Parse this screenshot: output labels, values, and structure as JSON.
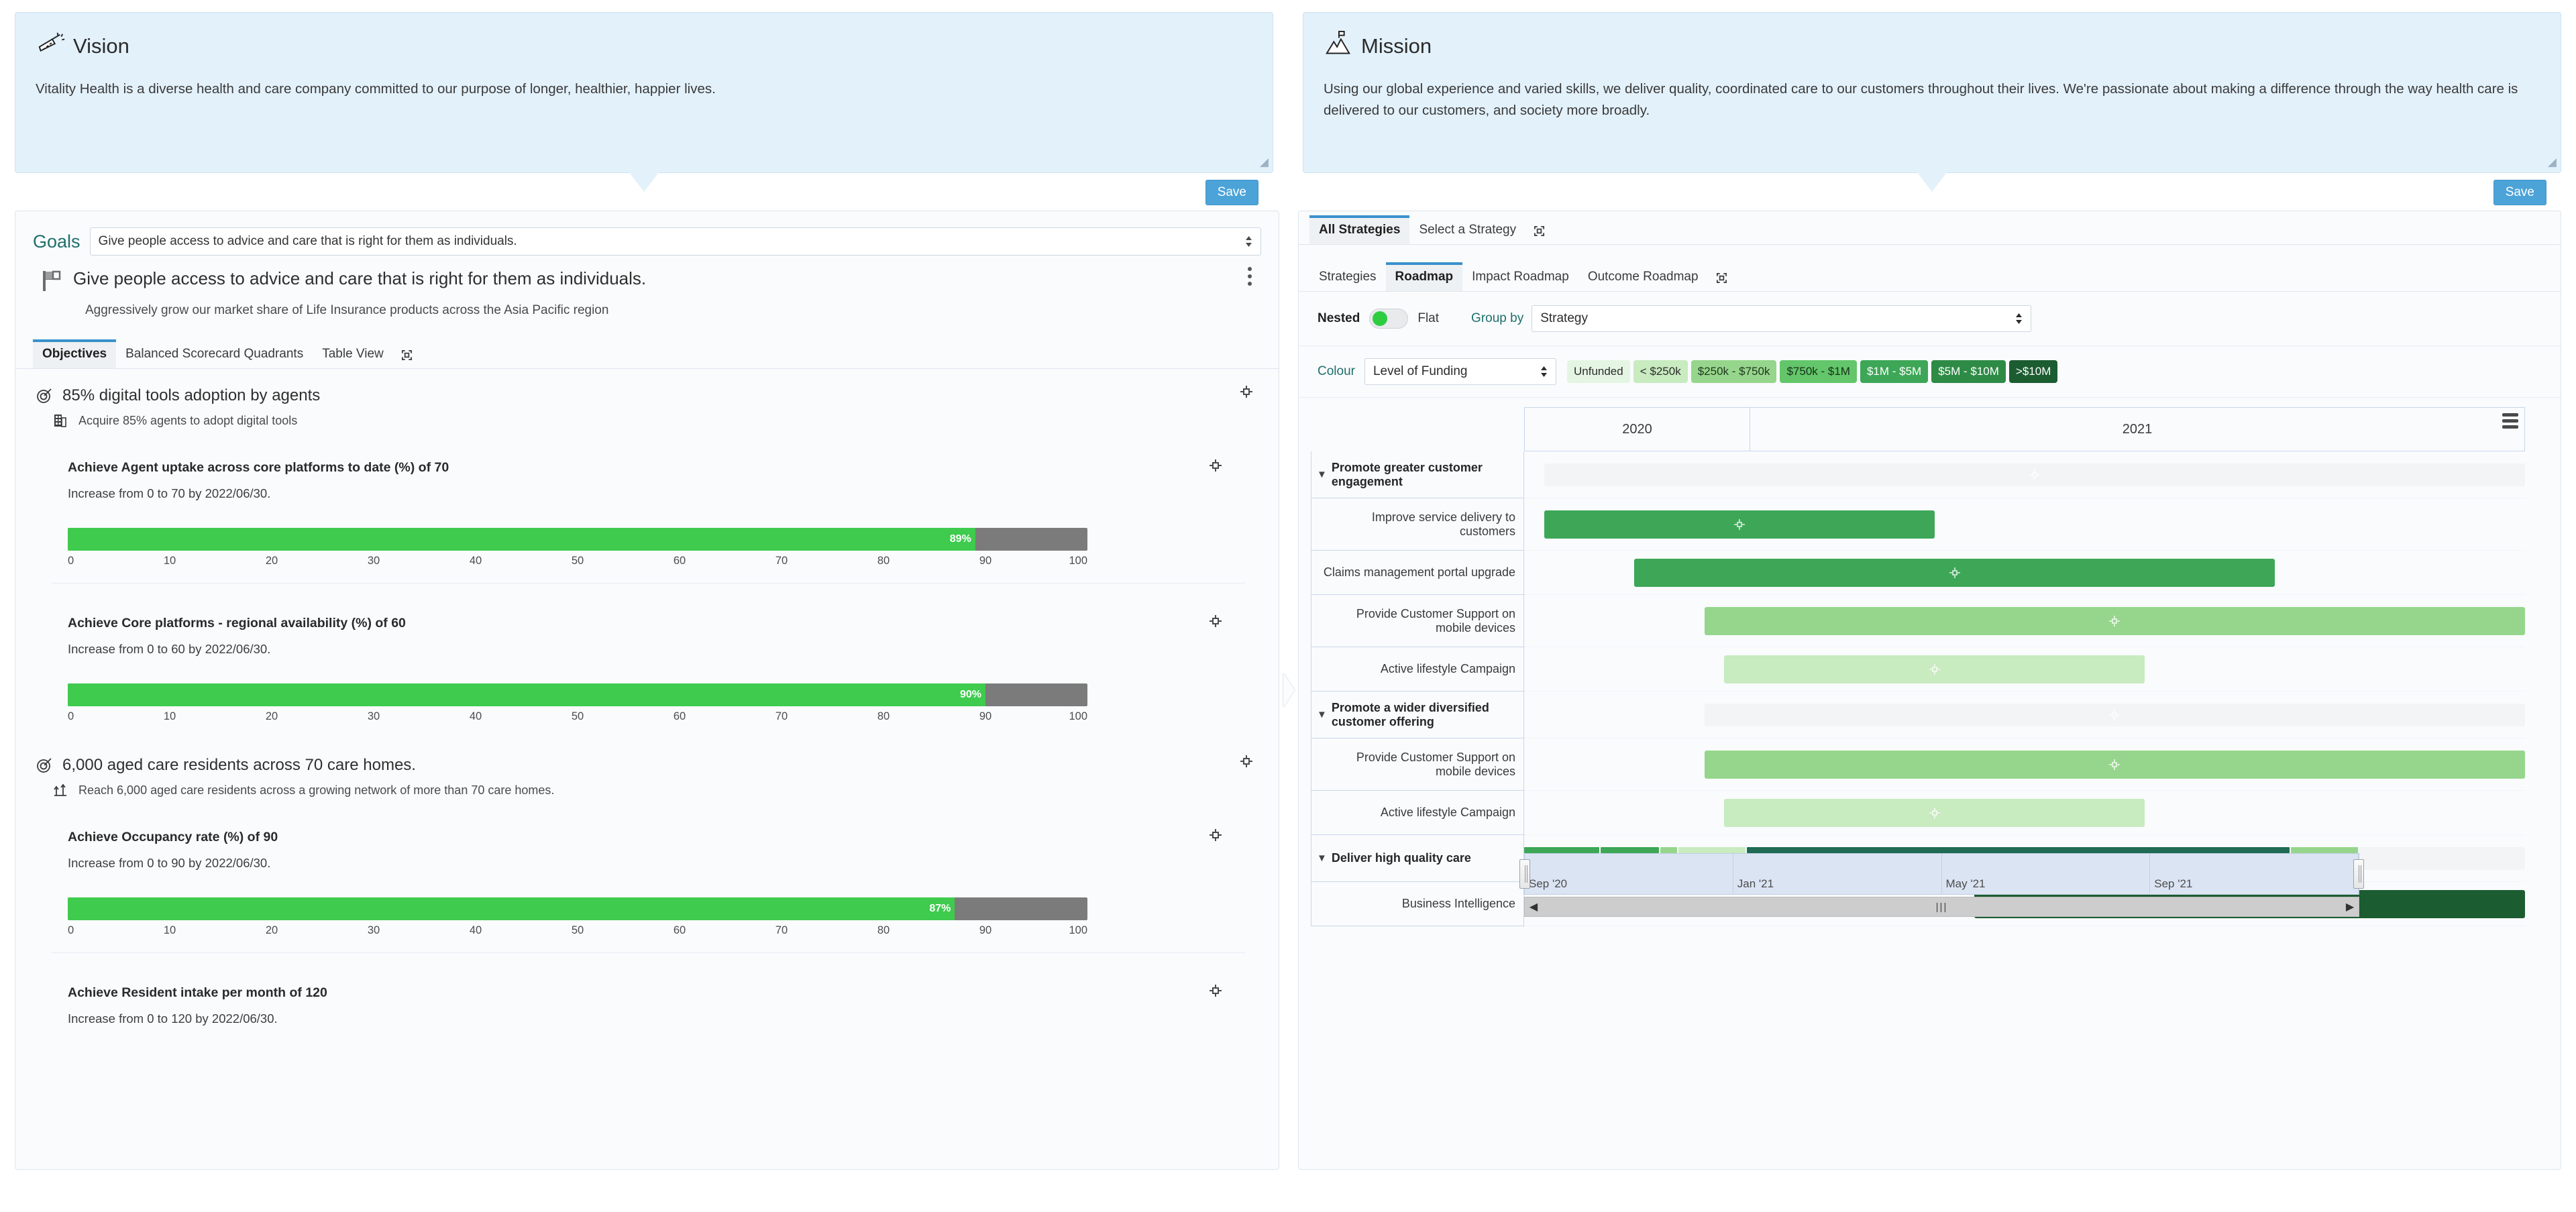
{
  "vision": {
    "title": "Vision",
    "icon": "telescope-icon",
    "text": "Vitality Health is a diverse health and care company committed to our purpose of longer, healthier, happier lives.",
    "save_label": "Save"
  },
  "mission": {
    "title": "Mission",
    "icon": "summit-flag-icon",
    "text": "Using our global experience and varied skills, we deliver quality, coordinated care to our customers throughout their lives. We're passionate about making a difference through the way health care is delivered to our customers, and society more broadly.",
    "save_label": "Save"
  },
  "goals": {
    "label": "Goals",
    "selected": "Give people access to advice and care that is right for them as individuals.",
    "goal_title": "Give people access to advice and care that is right for them as individuals.",
    "goal_subtitle": "Aggressively grow our market share of Life Insurance products across the Asia Pacific region",
    "tabs": [
      {
        "label": "Objectives",
        "active": true
      },
      {
        "label": "Balanced Scorecard Quadrants",
        "active": false
      },
      {
        "label": "Table View",
        "active": false
      }
    ],
    "objectives": [
      {
        "title": "85% digital tools adoption by agents",
        "subtitle": "Acquire 85% agents to adopt digital tools",
        "key_results": [
          {
            "title": "Achieve Agent uptake across core platforms to date (%) of 70",
            "desc": "Increase from 0 to 70 by 2022/06/30.",
            "percent": 89,
            "percent_label": "89%"
          },
          {
            "title": "Achieve Core platforms - regional availability (%) of 60",
            "desc": "Increase from 0 to 60 by 2022/06/30.",
            "percent": 90,
            "percent_label": "90%"
          }
        ]
      },
      {
        "title": "6,000 aged care residents across 70 care homes.",
        "subtitle": "Reach 6,000 aged care residents across a growing network of more than 70 care homes.",
        "key_results": [
          {
            "title": "Achieve Occupancy rate (%) of 90",
            "desc": "Increase from 0 to 90 by 2022/06/30.",
            "percent": 87,
            "percent_label": "87%"
          },
          {
            "title": "Achieve Resident intake per month of 120",
            "desc": "Increase from 0 to 120 by 2022/06/30.",
            "percent": 0,
            "percent_label": ""
          }
        ]
      }
    ],
    "axis_ticks": [
      "0",
      "10",
      "20",
      "30",
      "40",
      "50",
      "60",
      "70",
      "80",
      "90",
      "100"
    ]
  },
  "strategy": {
    "outer_tabs": [
      {
        "label": "All Strategies",
        "active": true
      },
      {
        "label": "Select a Strategy",
        "active": false
      }
    ],
    "inner_tabs": [
      {
        "label": "Strategies",
        "active": false
      },
      {
        "label": "Roadmap",
        "active": true
      },
      {
        "label": "Impact Roadmap",
        "active": false
      },
      {
        "label": "Outcome Roadmap",
        "active": false
      }
    ],
    "controls": {
      "nested_label": "Nested",
      "flat_label": "Flat",
      "toggle_state": "nested",
      "group_by_label": "Group by",
      "group_by_value": "Strategy",
      "colour_label": "Colour",
      "colour_value": "Level of Funding"
    },
    "legend": [
      {
        "label": "Unfunded",
        "bg": "#e5f5e3",
        "fg": "#2c2c2c"
      },
      {
        "label": "< $250k",
        "bg": "#c8ebc0",
        "fg": "#2c2c2c"
      },
      {
        "label": "$250k - $750k",
        "bg": "#96d68c",
        "fg": "#20381f"
      },
      {
        "label": "$750k - $1M",
        "bg": "#63c66a",
        "fg": "#16301a"
      },
      {
        "label": "$1M - $5M",
        "bg": "#3da757",
        "fg": "#ffffff"
      },
      {
        "label": "$5M - $10M",
        "bg": "#2e8b46",
        "fg": "#ffffff"
      },
      {
        "label": ">$10M",
        "bg": "#1c5c31",
        "fg": "#ffffff"
      }
    ]
  },
  "chart_data": {
    "type": "bar",
    "title": "Roadmap",
    "xlabel": "",
    "ylabel": "",
    "axis_years": [
      "2020",
      "2021"
    ],
    "minimap_ticks": [
      "Sep '20",
      "Jan '21",
      "May '21",
      "Sep '21"
    ],
    "rows": [
      {
        "label": "Promote greater customer engagement",
        "type": "group",
        "start_pct": 2,
        "end_pct": 100,
        "color": "#f3f4f5"
      },
      {
        "label": "Improve service delivery to customers",
        "type": "task",
        "start_pct": 2,
        "end_pct": 41,
        "color": "#3da757"
      },
      {
        "label": "Claims management portal upgrade",
        "type": "task",
        "start_pct": 11,
        "end_pct": 75,
        "color": "#3da757"
      },
      {
        "label": "Provide Customer Support on mobile devices",
        "type": "task",
        "start_pct": 18,
        "end_pct": 100,
        "color": "#96d68c"
      },
      {
        "label": "Active lifestyle Campaign",
        "type": "task",
        "start_pct": 20,
        "end_pct": 62,
        "color": "#c8ebc0"
      },
      {
        "label": "Promote a wider diversified customer offering",
        "type": "group",
        "start_pct": 18,
        "end_pct": 100,
        "color": "#f3f4f5"
      },
      {
        "label": "Provide Customer Support on mobile devices",
        "type": "task",
        "start_pct": 18,
        "end_pct": 100,
        "color": "#96d68c"
      },
      {
        "label": "Active lifestyle Campaign",
        "type": "task",
        "start_pct": 20,
        "end_pct": 62,
        "color": "#c8ebc0"
      },
      {
        "label": "Deliver high quality care",
        "type": "group",
        "start_pct": 38,
        "end_pct": 100,
        "color": "#f3f4f5"
      },
      {
        "label": "Business Intelligence",
        "type": "task",
        "start_pct": 45,
        "end_pct": 110,
        "color": "#1c5c31"
      }
    ],
    "minimap_segments": [
      {
        "width_pct": 9,
        "color": "#3da757"
      },
      {
        "width_pct": 7,
        "color": "#3da757"
      },
      {
        "width_pct": 2,
        "color": "#96d68c"
      },
      {
        "width_pct": 8,
        "color": "#c8ebc0"
      },
      {
        "width_pct": 65,
        "color": "#1f6b53"
      },
      {
        "width_pct": 8,
        "color": "#96d68c"
      }
    ]
  }
}
